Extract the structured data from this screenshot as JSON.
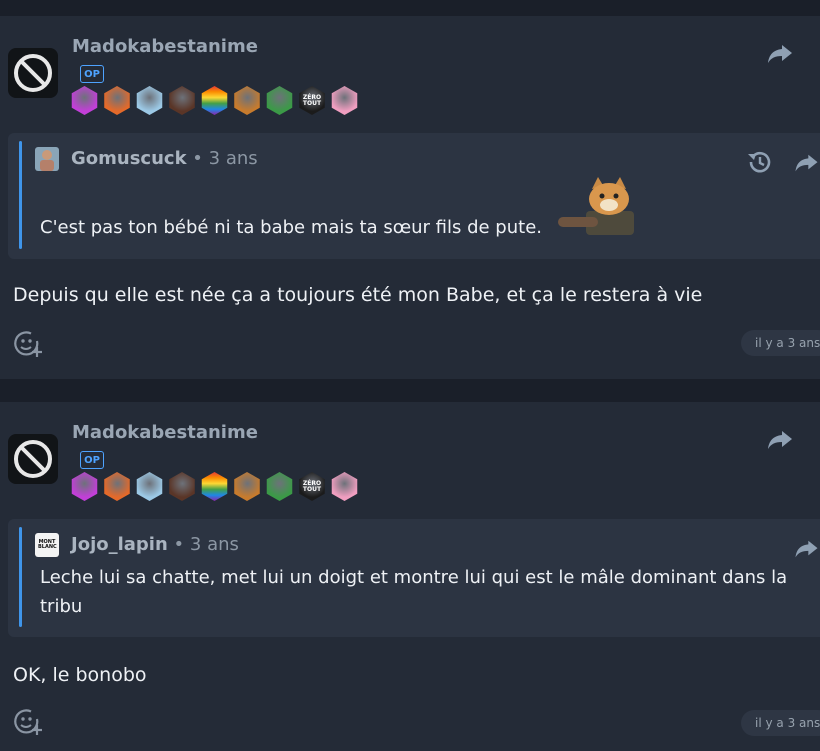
{
  "posts": [
    {
      "author": "Madokabestanime",
      "op_label": "OP",
      "badges": [
        {
          "icon": "swirl-badge-icon",
          "color": "#c23fd8"
        },
        {
          "icon": "chicken-badge-icon",
          "color": "#e46a2a"
        },
        {
          "icon": "old-man-badge-icon",
          "color": "#9cc9e6"
        },
        {
          "icon": "man-badge-icon",
          "color": "#5a3527"
        },
        {
          "icon": "rainbow-badge-icon",
          "color": "#f7b731"
        },
        {
          "icon": "cartoon-badge-icon",
          "color": "#c77b2d"
        },
        {
          "icon": "elf-badge-icon",
          "color": "#3b9a47"
        },
        {
          "icon": "zero-tout-badge-icon",
          "color": "#1b1b1b",
          "text": "ZÉRO TOUT"
        },
        {
          "icon": "anime-girl-badge-icon",
          "color": "#f09ec0"
        }
      ],
      "quote": {
        "author": "Gomuscuck",
        "separator": "•",
        "age": "3 ans",
        "text": "C'est pas ton bébé ni ta babe mais ta sœur fils de pute."
      },
      "body": "Depuis qu elle est née ça a toujours été mon Babe, et ça le restera à vie",
      "date": "il y a 3 ans"
    },
    {
      "author": "Madokabestanime",
      "op_label": "OP",
      "badges": [
        {
          "icon": "swirl-badge-icon",
          "color": "#c23fd8"
        },
        {
          "icon": "chicken-badge-icon",
          "color": "#e46a2a"
        },
        {
          "icon": "old-man-badge-icon",
          "color": "#9cc9e6"
        },
        {
          "icon": "man-badge-icon",
          "color": "#5a3527"
        },
        {
          "icon": "rainbow-badge-icon",
          "color": "#f7b731"
        },
        {
          "icon": "cartoon-badge-icon",
          "color": "#c77b2d"
        },
        {
          "icon": "elf-badge-icon",
          "color": "#3b9a47"
        },
        {
          "icon": "zero-tout-badge-icon",
          "color": "#1b1b1b",
          "text": "ZÉRO TOUT"
        },
        {
          "icon": "anime-girl-badge-icon",
          "color": "#f09ec0"
        }
      ],
      "quote": {
        "author": "Jojo_lapin",
        "separator": "•",
        "age": "3 ans",
        "avatar_text": "MONT BLANC",
        "text": "Leche lui sa chatte, met lui un doigt et montre lui qui est le mâle dominant dans la tribu"
      },
      "body": "OK, le bonobo",
      "date": "il y a 3 ans"
    }
  ],
  "colors": {
    "background": "#1a1f29",
    "card": "#242b37",
    "quote_background": "#2c3442",
    "quote_bar": "#3f95ea",
    "op_badge": "#4ea3ff"
  }
}
